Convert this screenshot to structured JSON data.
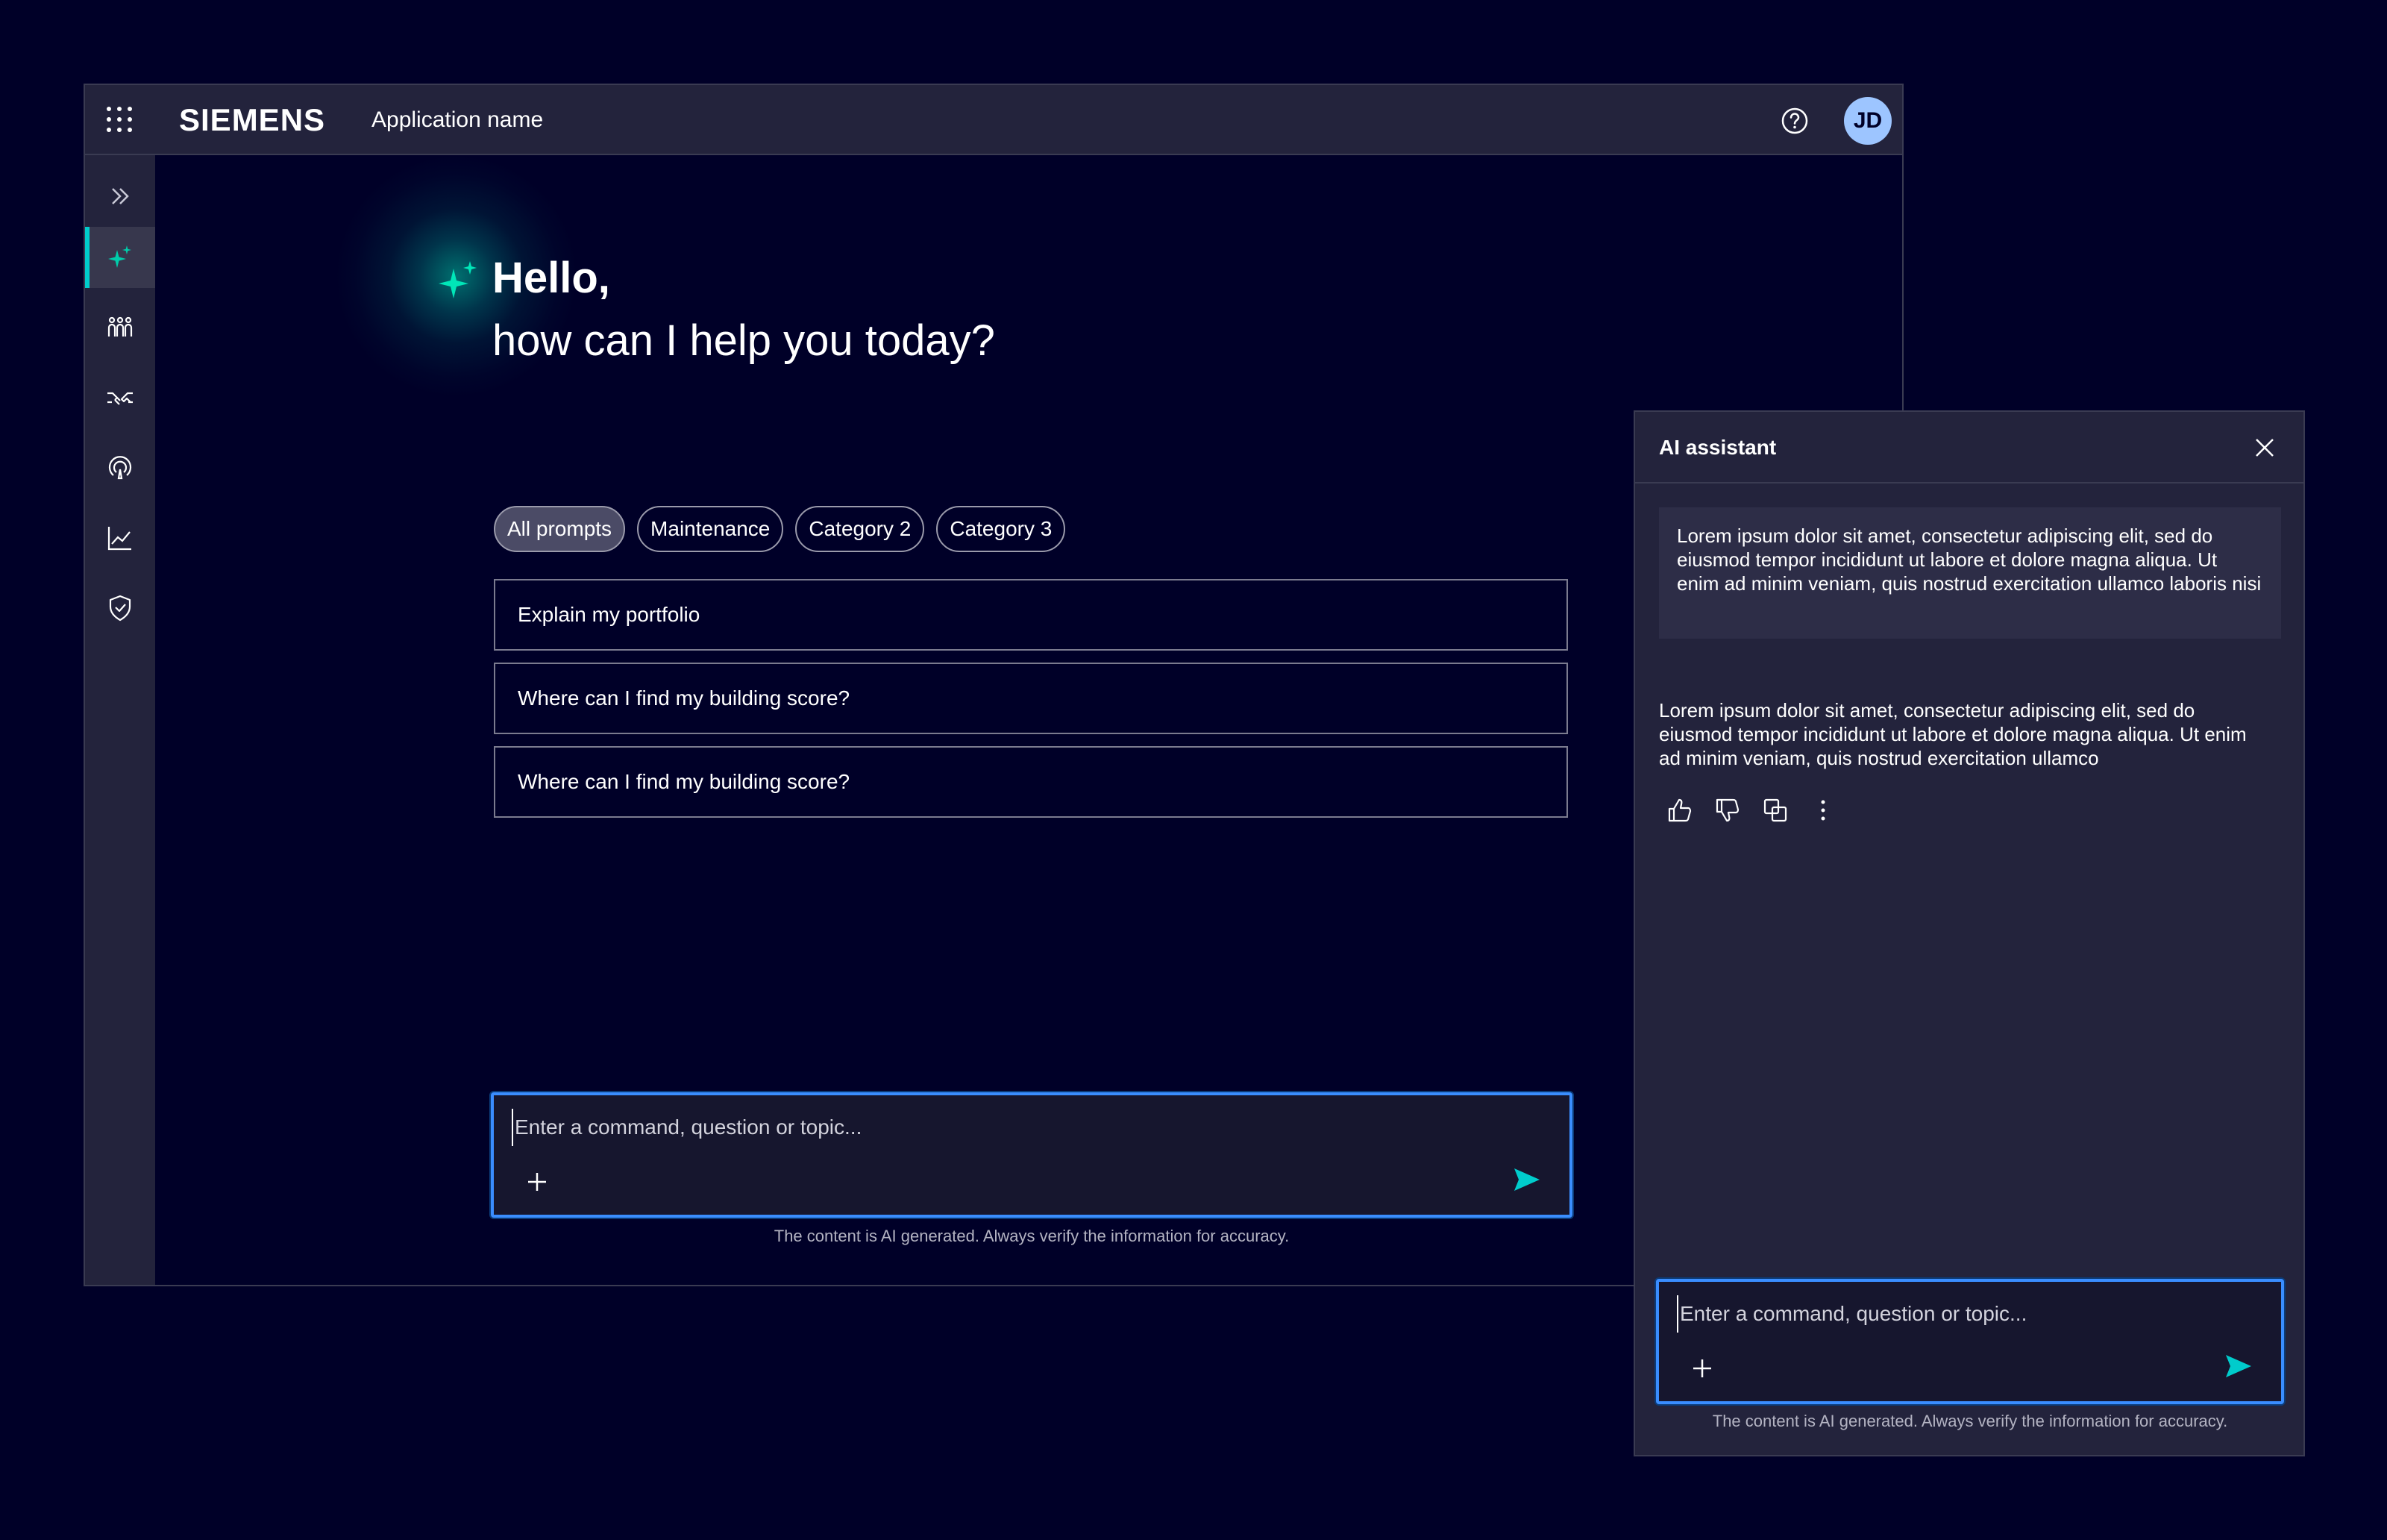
{
  "header": {
    "brand": "SIEMENS",
    "app_name": "Application name",
    "avatar_initials": "JD"
  },
  "sidebar": {
    "items": [
      {
        "name": "expand",
        "icon": "chevrons-right-icon"
      },
      {
        "name": "ai",
        "icon": "sparkle-icon",
        "active": true
      },
      {
        "name": "people",
        "icon": "group-icon"
      },
      {
        "name": "handshake",
        "icon": "handshake-icon"
      },
      {
        "name": "podcast",
        "icon": "signal-icon"
      },
      {
        "name": "analytics",
        "icon": "line-chart-icon"
      },
      {
        "name": "security",
        "icon": "shield-check-icon"
      }
    ]
  },
  "hero": {
    "greeting": "Hello,",
    "subtitle": "how can I help you today?"
  },
  "categories": [
    {
      "label": "All prompts",
      "active": true
    },
    {
      "label": "Maintenance",
      "active": false
    },
    {
      "label": "Category 2",
      "active": false
    },
    {
      "label": "Category 3",
      "active": false
    }
  ],
  "prompts": [
    "Explain my portfolio",
    "Where can I find my building score?",
    "Where can I find my building score?"
  ],
  "composer": {
    "placeholder": "Enter a command, question or topic...",
    "disclaimer": "The content is AI generated. Always verify the information for accuracy."
  },
  "ai_panel": {
    "title": "AI assistant",
    "user_message": "Lorem ipsum dolor sit amet, consectetur adipiscing elit, sed do eiusmod tempor incididunt ut labore et dolore magna aliqua. Ut enim ad minim veniam, quis nostrud exercitation ullamco laboris nisi",
    "ai_message": "Lorem ipsum dolor sit amet, consectetur adipiscing elit, sed do eiusmod tempor incididunt ut labore et dolore magna aliqua. Ut enim ad minim veniam, quis nostrud exercitation ullamco",
    "composer_placeholder": "Enter a command, question or topic...",
    "disclaimer": "The content is AI generated. Always verify the information for accuracy."
  },
  "colors": {
    "background": "#000028",
    "surface": "#23233c",
    "accent": "#00cccc",
    "focus": "#3a8dff",
    "avatar": "#9dc5ff"
  }
}
